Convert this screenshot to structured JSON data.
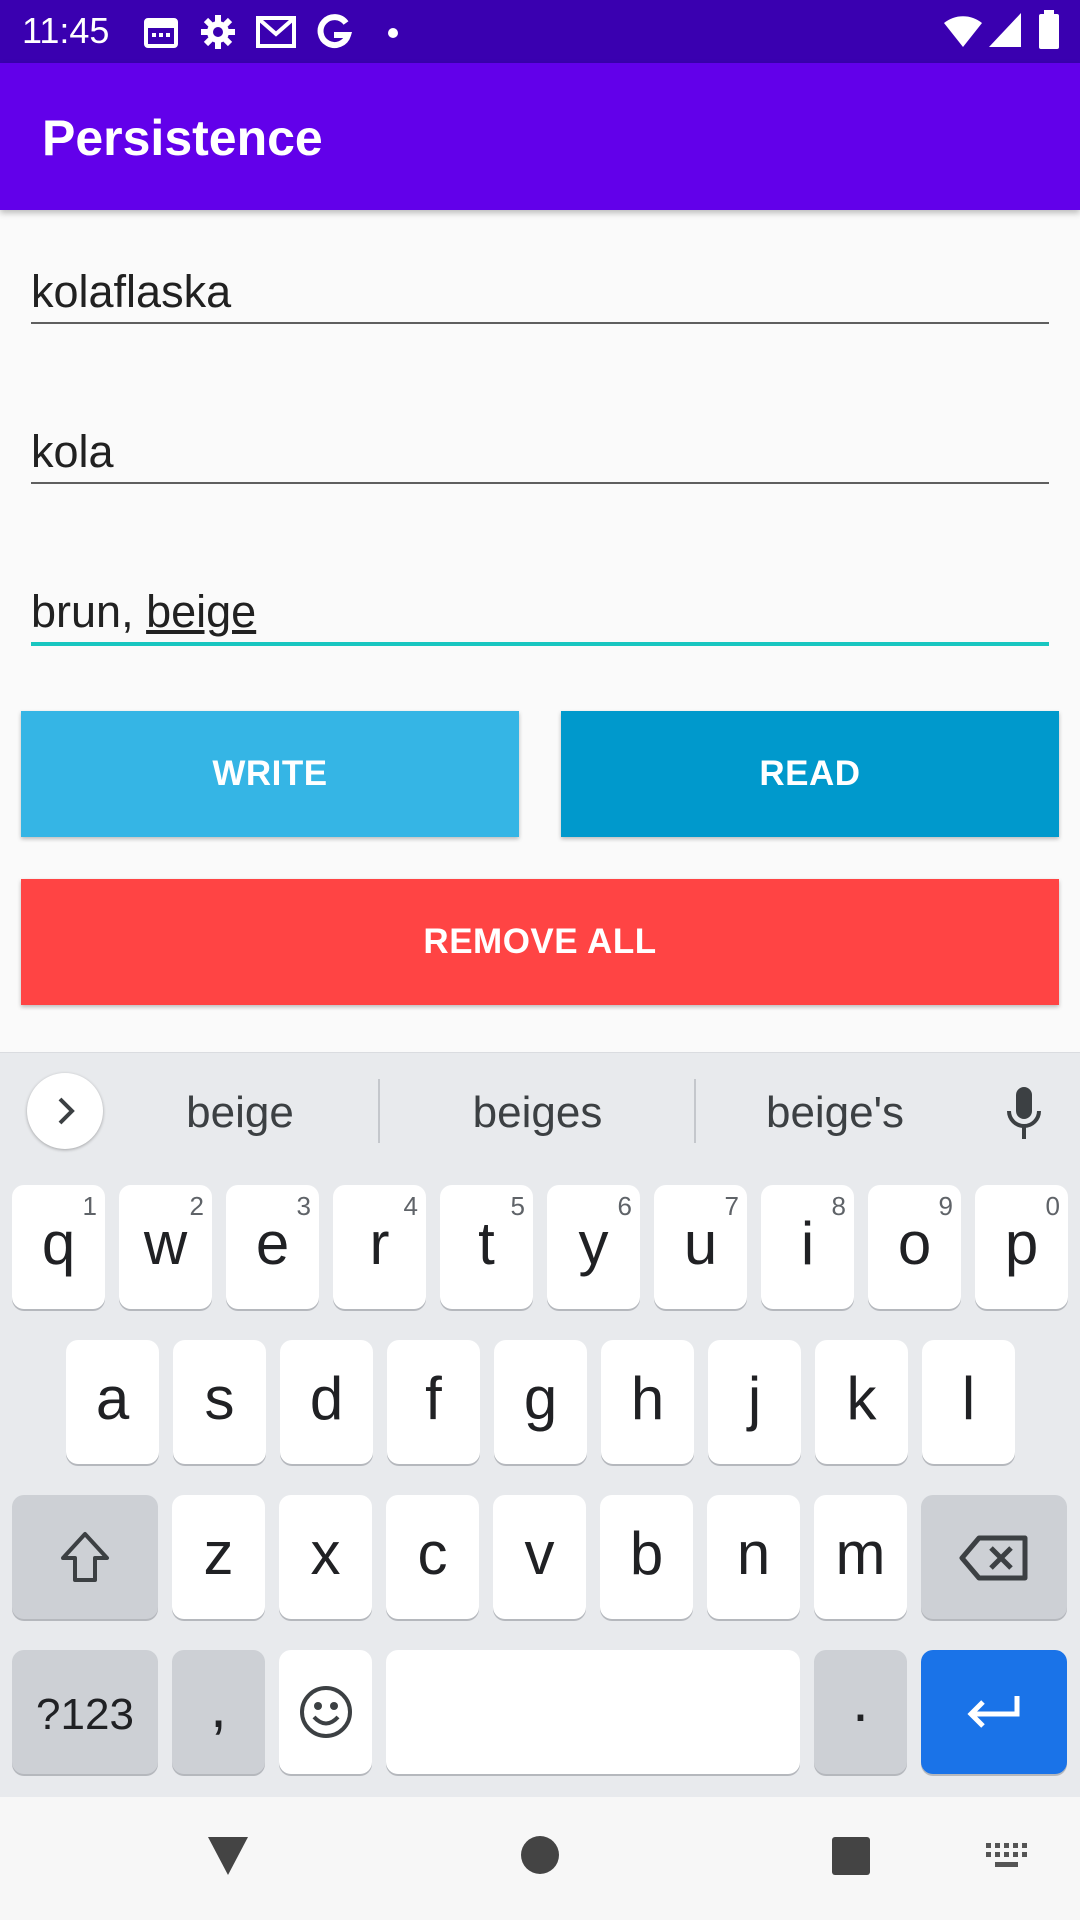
{
  "status_bar": {
    "time": "11:45",
    "icons": [
      "calendar-icon",
      "settings-icon",
      "gmail-icon",
      "google-icon",
      "dot-icon"
    ],
    "right_icons": [
      "wifi-icon",
      "signal-icon",
      "battery-icon"
    ]
  },
  "app_bar": {
    "title": "Persistence"
  },
  "form": {
    "field1_value": "kolaflaska",
    "field2_value": "kola",
    "field3_prefix": "brun, ",
    "field3_composing": "beige"
  },
  "buttons": {
    "write": "WRITE",
    "read": "READ",
    "remove_all": "REMOVE ALL"
  },
  "keyboard": {
    "suggestions": [
      "beige",
      "beiges",
      "beige's"
    ],
    "row1": [
      {
        "letter": "q",
        "hint": "1"
      },
      {
        "letter": "w",
        "hint": "2"
      },
      {
        "letter": "e",
        "hint": "3"
      },
      {
        "letter": "r",
        "hint": "4"
      },
      {
        "letter": "t",
        "hint": "5"
      },
      {
        "letter": "y",
        "hint": "6"
      },
      {
        "letter": "u",
        "hint": "7"
      },
      {
        "letter": "i",
        "hint": "8"
      },
      {
        "letter": "o",
        "hint": "9"
      },
      {
        "letter": "p",
        "hint": "0"
      }
    ],
    "row2": [
      "a",
      "s",
      "d",
      "f",
      "g",
      "h",
      "j",
      "k",
      "l"
    ],
    "row3": [
      "z",
      "x",
      "c",
      "v",
      "b",
      "n",
      "m"
    ],
    "symbols_label": "?123",
    "comma_label": ",",
    "period_label": ".",
    "enter_color": "#1a73e8"
  },
  "colors": {
    "status_bar": "#3a00b0",
    "app_bar": "#6200ea",
    "write": "#35b5e5",
    "read": "#0099cc",
    "remove_all": "#ff4444",
    "focus_underline": "#18c6c0"
  }
}
